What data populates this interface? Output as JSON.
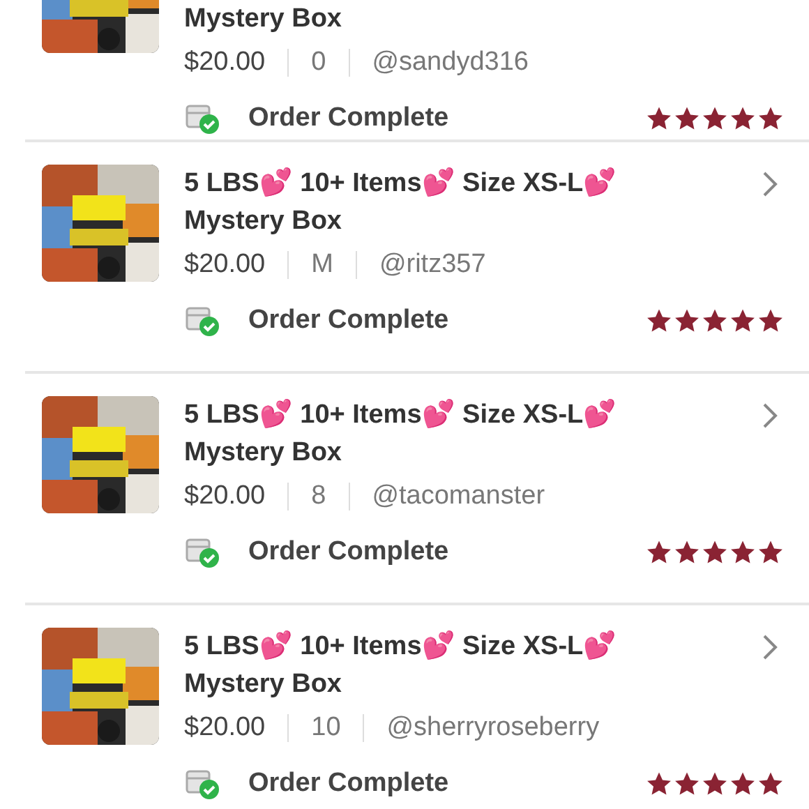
{
  "orders": [
    {
      "title": "Mystery Box",
      "price": "$20.00",
      "size": "0",
      "buyer": "@sandyd316",
      "status": "Order Complete",
      "stars": 5,
      "chevron": false
    },
    {
      "title": "5 LBS💕 10+ Items💕 Size XS-L💕 Mystery Box",
      "price": "$20.00",
      "size": "M",
      "buyer": "@ritz357",
      "status": "Order Complete",
      "stars": 5,
      "chevron": true
    },
    {
      "title": "5 LBS💕 10+ Items💕 Size XS-L💕 Mystery Box",
      "price": "$20.00",
      "size": "8",
      "buyer": "@tacomanster",
      "status": "Order Complete",
      "stars": 5,
      "chevron": true
    },
    {
      "title": "5 LBS💕 10+ Items💕 Size XS-L💕 Mystery Box",
      "price": "$20.00",
      "size": "10",
      "buyer": "@sherryroseberry",
      "status": "Order Complete",
      "stars": 5,
      "chevron": true
    }
  ]
}
